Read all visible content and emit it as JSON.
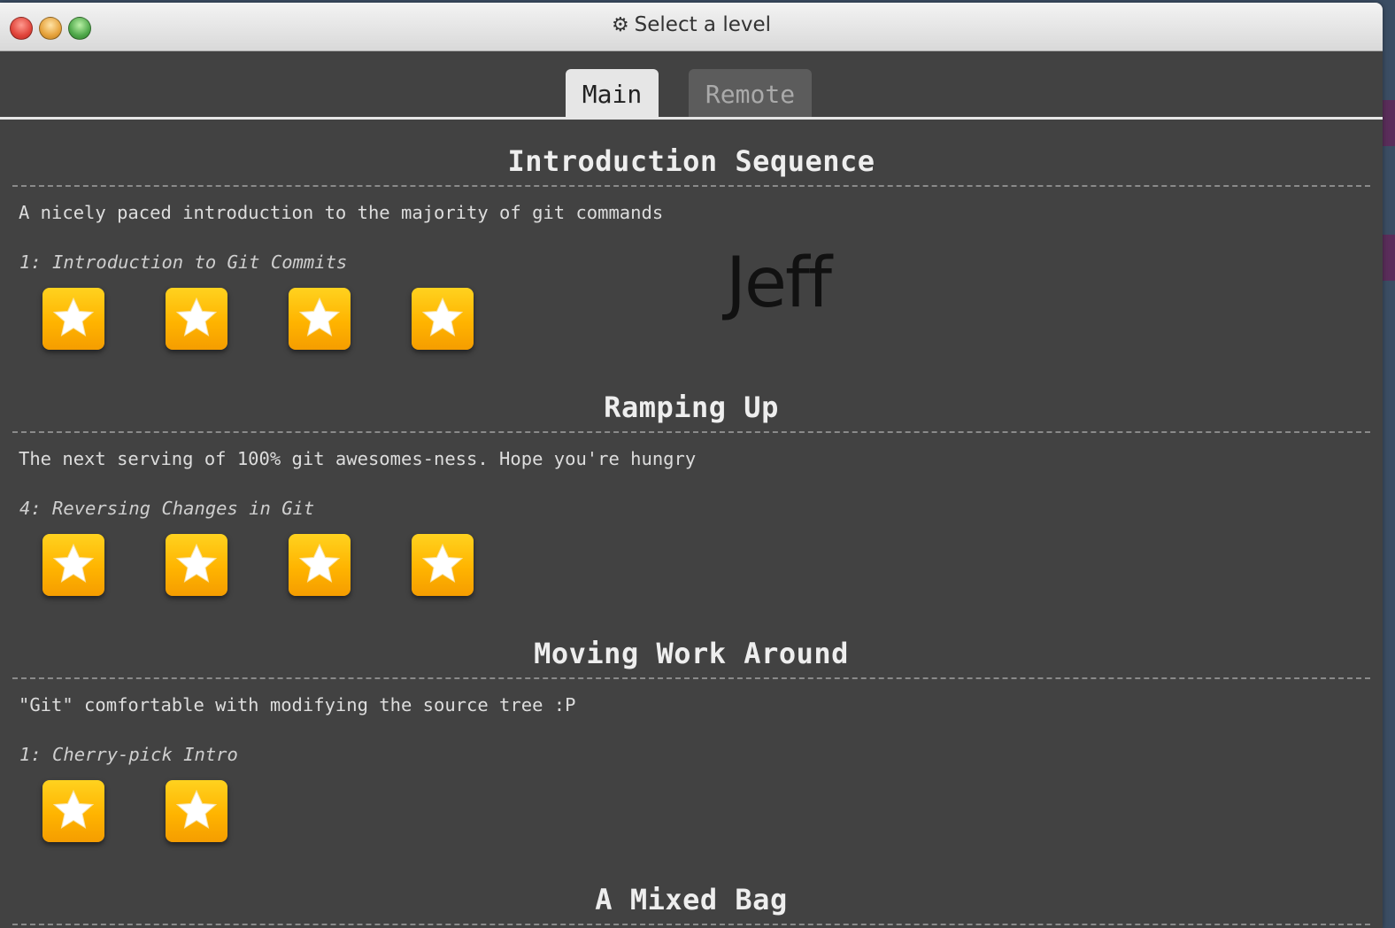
{
  "window": {
    "title": "Select a level",
    "title_icon": "gear-icon"
  },
  "tabs": [
    {
      "label": "Main",
      "active": true
    },
    {
      "label": "Remote",
      "active": false
    }
  ],
  "overlay_text": "Jeff",
  "sections": [
    {
      "title": "Introduction Sequence",
      "description": "A nicely paced introduction to the majority of git commands",
      "level_label": "1: Introduction to Git Commits",
      "star_count": 4
    },
    {
      "title": "Ramping Up",
      "description": "The next serving of 100% git awesomes-ness. Hope you're hungry",
      "level_label": "4: Reversing Changes in Git",
      "star_count": 4
    },
    {
      "title": "Moving Work Around",
      "description": "\"Git\" comfortable with modifying the source tree :P",
      "level_label": "1: Cherry-pick Intro",
      "star_count": 2
    },
    {
      "title": "A Mixed Bag",
      "description": "",
      "level_label": "",
      "star_count": 0
    }
  ],
  "colors": {
    "background": "#424242",
    "star_button": "#ffb400",
    "active_tab": "#e6e6e6",
    "inactive_tab": "#5c5c5c"
  }
}
